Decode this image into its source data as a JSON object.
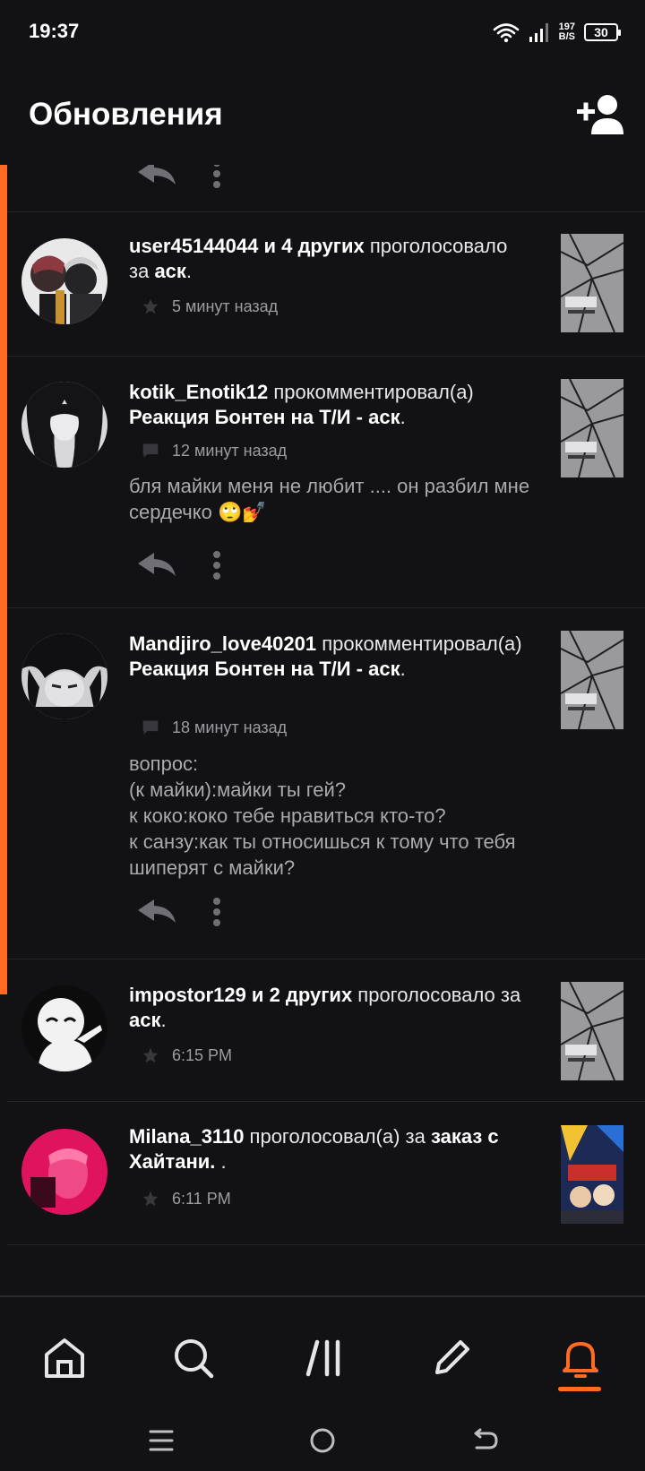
{
  "status_bar": {
    "time": "19:37",
    "speed_value": "197",
    "speed_unit": "B/S",
    "battery": "30"
  },
  "app_bar": {
    "title": "Обновления",
    "add_user_icon": "add-user-icon"
  },
  "colors": {
    "accent": "#ff6b22",
    "background": "#121114",
    "divider": "#26252a"
  },
  "feed": [
    {
      "type": "vote",
      "user": "user45144044 и 4 других",
      "action": " проголосовало за ",
      "target": "аск",
      "tail": ".",
      "time": "5 минут назад",
      "meta_icon": "star-icon"
    },
    {
      "type": "comment",
      "user": "kotik_Enotik12",
      "action": " прокомментировал(а) ",
      "target": "Реакция Бонтен на Т/И - аск",
      "tail": ".",
      "time": "12 минут назад",
      "meta_icon": "comment-icon",
      "comment": "бля майки меня не любит .... он разбил мне сердечко 🙄💅"
    },
    {
      "type": "comment",
      "user": "Mandjiro_love40201",
      "action": " прокомментировал(а) ",
      "target": "Реакция Бонтен на Т/И - аск",
      "tail": ".",
      "time": "18 минут назад",
      "meta_icon": "comment-icon",
      "comment": "вопрос:\n(к майки):майки ты гей?\nк коко:коко тебе нравиться кто-то?\nк санзу:как ты относишься к тому что тебя шиперят с майки?"
    },
    {
      "type": "vote",
      "user": "impostor129 и 2 других",
      "action": " проголосовало за ",
      "target": "аск",
      "tail": ".",
      "time": "6:15 PM",
      "meta_icon": "star-icon"
    },
    {
      "type": "vote",
      "user": "Milana_3110",
      "action": " проголосовал(а) за ",
      "target": "заказ с Хайтани.",
      "tail": " .",
      "time": "6:11 PM",
      "meta_icon": "star-icon"
    }
  ],
  "bottom_nav": {
    "items": [
      "home-icon",
      "search-icon",
      "library-icon",
      "write-icon",
      "notifications-icon"
    ],
    "active": "notifications-icon"
  },
  "system_nav": [
    "menu-icon",
    "home-circle-icon",
    "back-icon"
  ]
}
